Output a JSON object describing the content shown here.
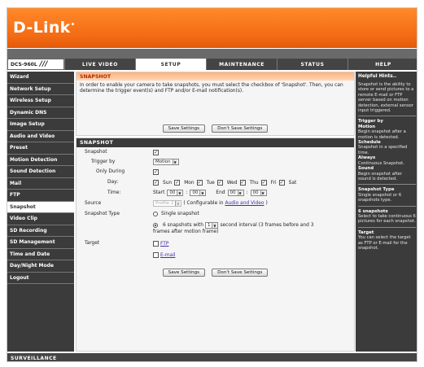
{
  "brand": {
    "logo_text": "D-Link"
  },
  "model": {
    "name": "DCS-960L",
    "slashes": "///"
  },
  "tabs": [
    {
      "label": "LIVE VIDEO"
    },
    {
      "label": "SETUP"
    },
    {
      "label": "MAINTENANCE"
    },
    {
      "label": "STATUS"
    },
    {
      "label": "HELP"
    }
  ],
  "active_tab": "SETUP",
  "sidebar": {
    "items": [
      {
        "label": "Wizard"
      },
      {
        "label": "Network Setup"
      },
      {
        "label": "Wireless Setup"
      },
      {
        "label": "Dynamic DNS"
      },
      {
        "label": "Image Setup"
      },
      {
        "label": "Audio and Video"
      },
      {
        "label": "Preset"
      },
      {
        "label": "Motion Detection"
      },
      {
        "label": "Sound Detection"
      },
      {
        "label": "Mail"
      },
      {
        "label": "FTP"
      },
      {
        "label": "Snapshot"
      },
      {
        "label": "Video Clip"
      },
      {
        "label": "SD Recording"
      },
      {
        "label": "SD Management"
      },
      {
        "label": "Time and Date"
      },
      {
        "label": "Day/Night Mode"
      },
      {
        "label": "Logout"
      }
    ],
    "active": "Snapshot"
  },
  "intro": {
    "title": "SNAPSHOT",
    "text": "In order to enable your camera to take snapshots, you must select the checkbox of 'Snapshot'. Then, you can determine the trigger event(s) and FTP and/or E-mail notification(s).",
    "save_label": "Save Settings",
    "dont_save_label": "Don't Save Settings"
  },
  "form": {
    "title": "SNAPSHOT",
    "snapshot_label": "Snapshot",
    "snapshot_checked": "✓",
    "trigger_label": "Trigger by",
    "trigger_value": "Motion",
    "only_during_label": "Only During",
    "only_during_checked": "✓",
    "day_label": "Day:",
    "days": [
      {
        "label": "Sun",
        "checked": "✓"
      },
      {
        "label": "Mon",
        "checked": "✓"
      },
      {
        "label": "Tue",
        "checked": "✓"
      },
      {
        "label": "Wed",
        "checked": "✓"
      },
      {
        "label": "Thu",
        "checked": "✓"
      },
      {
        "label": "Fri",
        "checked": "✓"
      },
      {
        "label": "Sat",
        "checked": "✓"
      }
    ],
    "time_label": "Time:",
    "start_label": "Start",
    "start_h": "00",
    "start_m": "00",
    "end_label": "End",
    "end_h": "00",
    "end_m": "00",
    "time_sep": ":",
    "source_label": "Source",
    "source_value": "Profile 2",
    "source_note_pre": "( Configurable in ",
    "source_note_link": "Audio and Video",
    "source_note_post": " )",
    "type_label": "Snapshot Type",
    "type_single": "Single snapshot",
    "type_multi_pre": "6 snapshots with",
    "type_multi_value": "1",
    "type_multi_post": "second interval (3 frames before and 3",
    "type_multi_post2": "frames after motion frame)",
    "target_label": "Target",
    "target_ftp": "FTP",
    "target_email": "E-mail",
    "save_label": "Save Settings",
    "dont_save_label": "Don't Save Settings"
  },
  "help": {
    "title": "Helpful Hints..",
    "blocks": [
      {
        "head": "",
        "text": "Snapshot is the ability to store or send pictures to a remote E-mail or FTP server based on motion detection, external sensor input triggered."
      },
      {
        "head": "Trigger by",
        "text": ""
      },
      {
        "head": "Motion",
        "text": "Begin snapshot after a motion is detected."
      },
      {
        "head": "Schedule",
        "text": "Snapshot in a specified time."
      },
      {
        "head": "Always",
        "text": "Continuous Snapshot."
      },
      {
        "head": "Sound",
        "text": "Begin snapshot after sound is detected."
      },
      {
        "head": "Snapshot Type",
        "text": "Single snapshot or 6 snapshots type."
      },
      {
        "head": "6 snapshots",
        "text": "Select to take continuous 6 pictures for each snapshot."
      },
      {
        "head": "Target",
        "text": "You can select the target as FTP or E-mail for the snapshot."
      }
    ]
  },
  "footer": {
    "text": "SURVEILLANCE"
  },
  "colors": {
    "brand_orange": "#f46b14",
    "dark_panel": "#3b3b3b",
    "section_header": "#ffb27a"
  }
}
